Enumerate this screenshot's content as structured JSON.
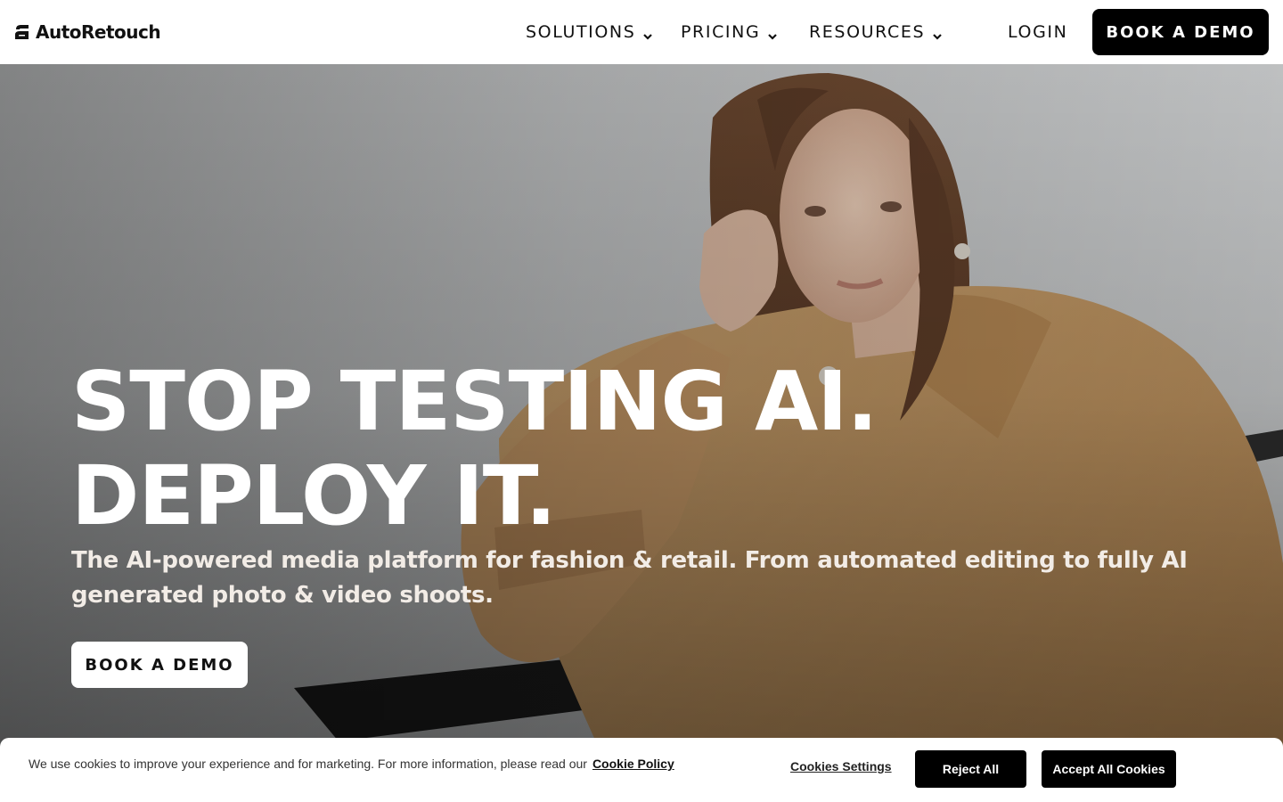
{
  "header": {
    "logo_text": "AutoRetouch",
    "logo_icon": "autoretouch-logo-icon",
    "nav": {
      "solutions": "SOLUTIONS",
      "pricing": "PRICING",
      "resources": "RESOURCES",
      "login": "LOGIN"
    },
    "cta": "BOOK A DEMO"
  },
  "hero": {
    "headline": "STOP TESTING AI. DEPLOY IT.",
    "subheadline": "The AI-powered media platform for fashion & retail. From automated editing to fully AI generated photo & video shoots.",
    "cta": "BOOK A DEMO"
  },
  "cookie_banner": {
    "text": "We use cookies to improve your experience and for marketing. For more information, please read our",
    "policy_link": "Cookie Policy",
    "settings": "Cookies Settings",
    "reject": "Reject All",
    "accept": "Accept All Cookies"
  },
  "colors": {
    "primary": "#000000",
    "background": "#ffffff",
    "hero_text": "#ffffff",
    "coat": "#b98f5e"
  },
  "icons": [
    "autoretouch-logo-icon",
    "chevron-down-icon"
  ]
}
